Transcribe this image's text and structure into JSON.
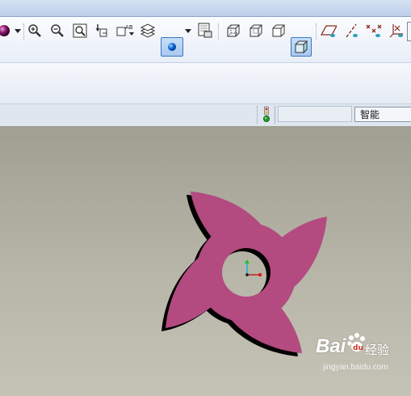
{
  "statusbar": {
    "filter_value": "智能"
  },
  "watermark": {
    "brand": "Bai",
    "brand_suffix": "经验",
    "url": "jingyan.baidu.com"
  },
  "icons": [
    "ball-icon",
    "zoom-in-icon",
    "zoom-out-icon",
    "zoom-fit-icon",
    "reorient-icon",
    "named-view-icon",
    "layers-icon",
    "display-style-icon",
    "view-manager-icon",
    "wireframe-icon",
    "hidden-line-icon",
    "no-hidden-icon",
    "shading-icon",
    "datum-plane-icon",
    "datum-axis-icon",
    "datum-point-icon",
    "coord-sys-icon",
    "traffic-light-icon",
    "coordinate-triad-icon",
    "paw-icon"
  ],
  "colors": {
    "part": "#b34a80",
    "part_shadow": "#000000",
    "viewport_top": "#a19f92",
    "viewport_bottom": "#c4c3b6",
    "active_button": "#a9c9ef"
  }
}
